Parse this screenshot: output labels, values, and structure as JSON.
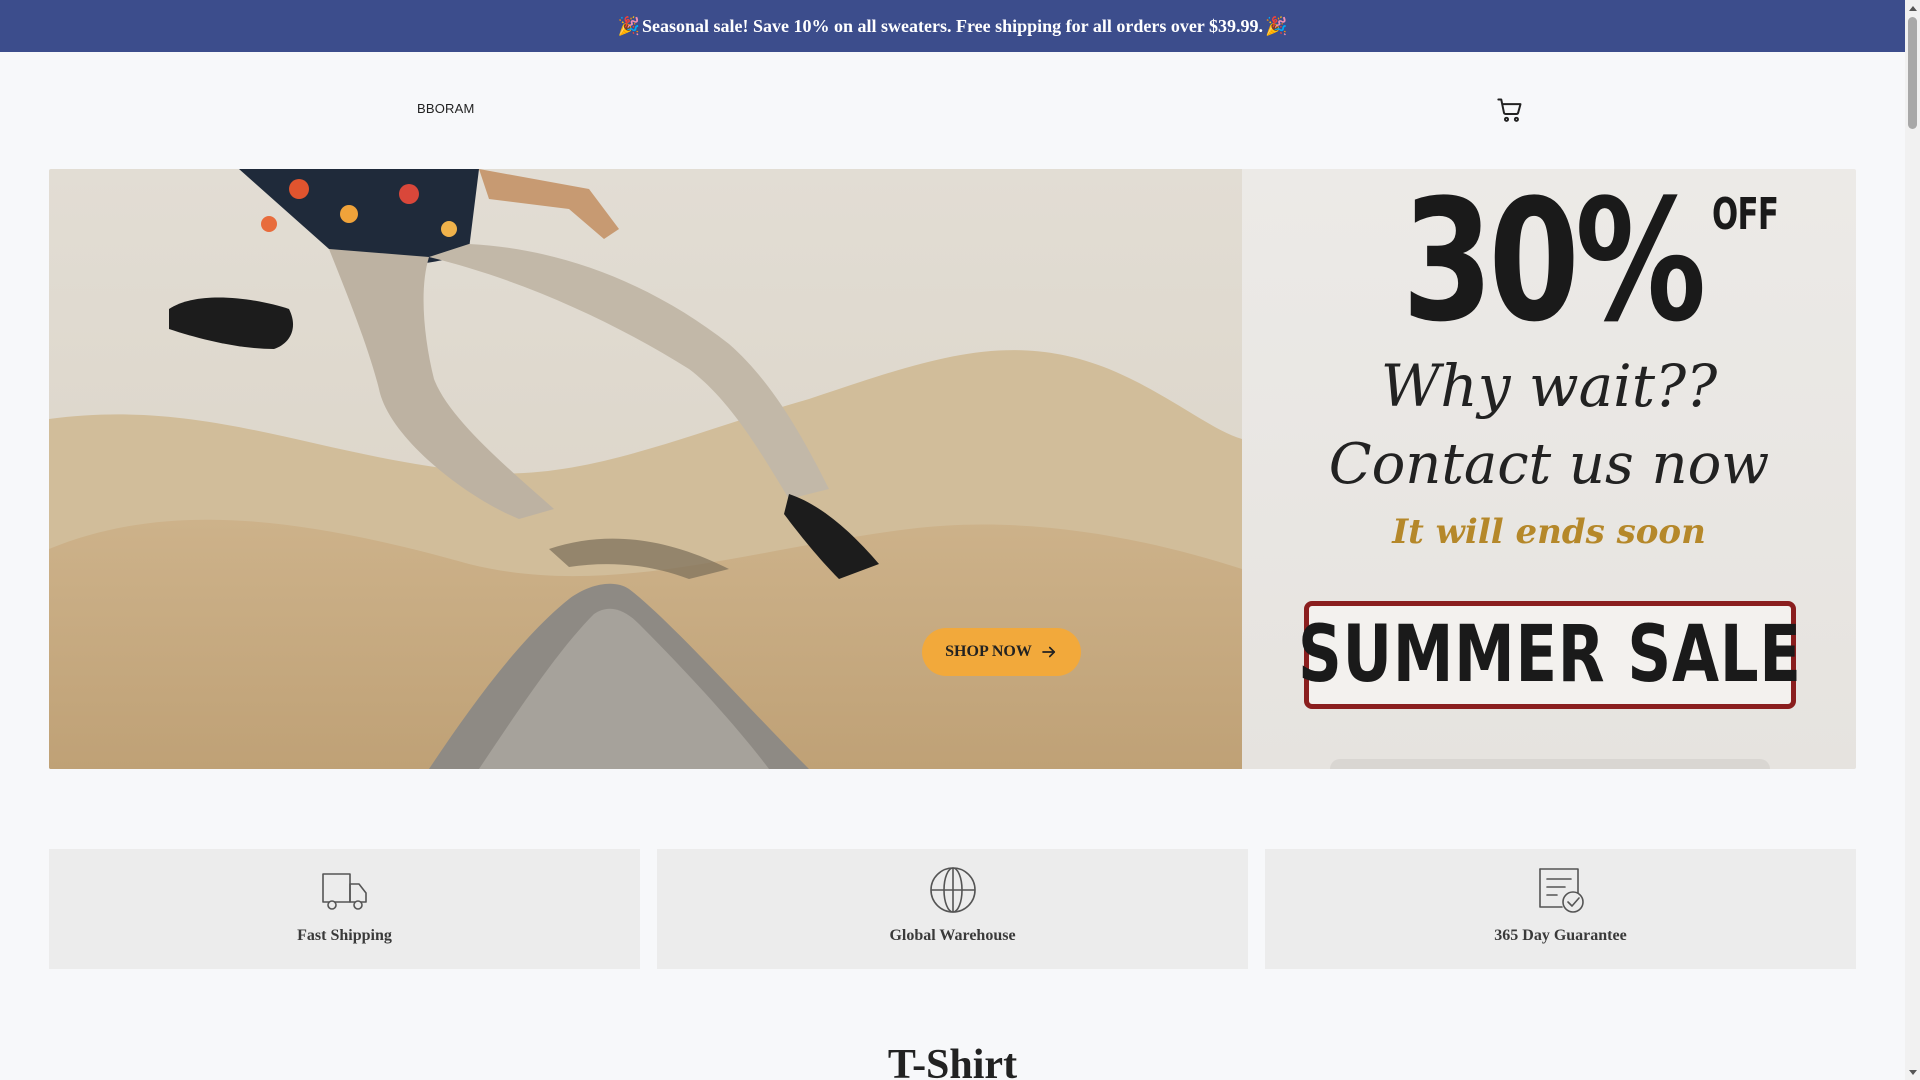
{
  "announcement": {
    "emoji_left": "🎉",
    "text": "Seasonal sale! Save 10% on all sweaters. Free shipping for all orders over $39.99.",
    "emoji_right": "🎉"
  },
  "header": {
    "logo": "BBORAM",
    "cart_icon": "cart-icon"
  },
  "hero": {
    "promo": {
      "percent": "30%",
      "off": "OFF",
      "line1": "Why wait??",
      "line2": "Contact us now",
      "line3": "It will ends soon",
      "badge": "SUMMER SALE"
    },
    "cta_label": "SHOP NOW",
    "cta_icon": "arrow-right-icon"
  },
  "features": [
    {
      "icon": "truck-icon",
      "label": "Fast Shipping"
    },
    {
      "icon": "globe-icon",
      "label": "Global Warehouse"
    },
    {
      "icon": "document-check-icon",
      "label": "365 Day Guarantee"
    }
  ],
  "section": {
    "title": "T-Shirt"
  },
  "colors": {
    "announcement_bg": "#3c4d8c",
    "cta_bg": "#f2a93b",
    "feature_bg": "#ececec",
    "page_bg": "#f7f8fa"
  }
}
